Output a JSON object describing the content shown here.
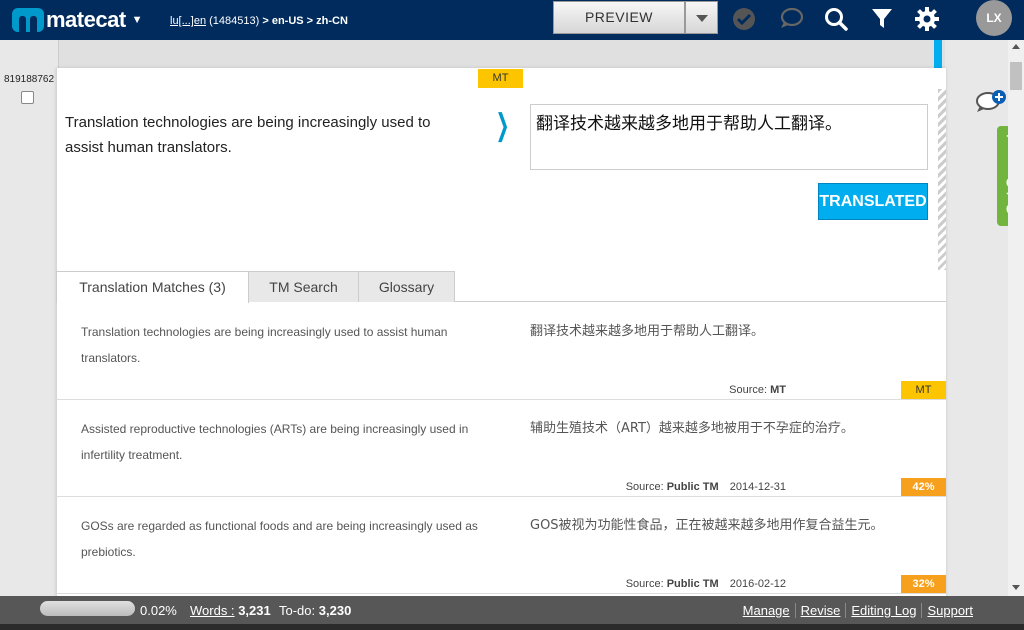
{
  "header": {
    "logo_text": "matecat",
    "job_name": "lu[...]en",
    "job_id": "(1484513)",
    "job_langs": "> en-US > zh-CN",
    "preview_label": "PREVIEW",
    "avatar_initials": "LX"
  },
  "segment": {
    "id": "819188762",
    "mt_tag": "MT",
    "source": "Translation technologies are being increasingly used to assist human translators.",
    "target": "翻译技术越来越多地用于帮助人工翻译。",
    "status_button": "TRANSLATED"
  },
  "tabs": [
    {
      "label": "Translation Matches (3)"
    },
    {
      "label": "TM Search"
    },
    {
      "label": "Glossary"
    }
  ],
  "matches": [
    {
      "source": "Translation technologies are being increasingly used to assist human translators.",
      "target": "翻译技术越来越多地用于帮助人工翻译。",
      "source_label": "Source:",
      "origin": "MT",
      "date": "",
      "badge": "MT"
    },
    {
      "source": "Assisted reproductive technologies (ARTs) are being increasingly used in infertility treatment.",
      "target": "辅助生殖技术（ART）越来越多地被用于不孕症的治疗。",
      "source_label": "Source:",
      "origin": "Public TM",
      "date": "2014-12-31",
      "badge": "42%"
    },
    {
      "source": "GOSs are regarded as functional foods and are being increasingly used as prebiotics.",
      "target": "GOS被视为功能性食品，正在被越来越多地用作复合益生元。",
      "source_label": "Source:",
      "origin": "Public TM",
      "date": "2016-02-12",
      "badge": "32%"
    }
  ],
  "side": {
    "get_support": "Get Support"
  },
  "footer": {
    "progress_percent": "0.02%",
    "progress_fraction": 0.0002,
    "words_label": "Words :",
    "words_value": "3,231",
    "todo_label": "To-do:",
    "todo_value": "3,230",
    "links": [
      "Manage",
      "Revise",
      "Editing Log",
      "Support"
    ]
  },
  "colors": {
    "header_bg": "#002b5c",
    "accent": "#00aeef",
    "mt_yellow": "#fdc500",
    "match_orange": "#f6a01d",
    "support_green": "#71b53f"
  }
}
